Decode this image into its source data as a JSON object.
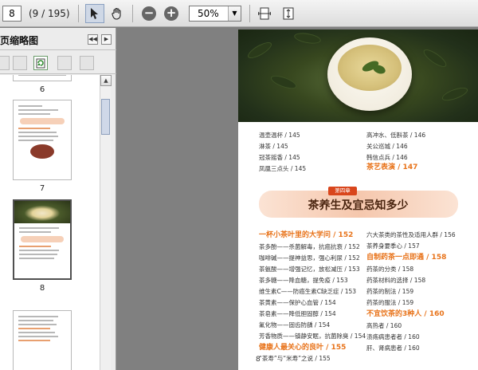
{
  "toolbar": {
    "page_number": "8",
    "page_count": "(9 / 195)",
    "zoom": "50%",
    "icons": [
      "select-icon",
      "hand-icon",
      "zoom-out-icon",
      "zoom-in-icon",
      "fit-width-icon",
      "fit-page-icon"
    ]
  },
  "panel": {
    "title": "页缩略图",
    "thumbnails": [
      {
        "label": "6"
      },
      {
        "label": "7"
      },
      {
        "label": "8"
      }
    ]
  },
  "page": {
    "left_col": [
      "温壶温杯 / 145",
      "淋茶 / 145",
      "冠茶摇香 / 145",
      "凤凰三点头 / 145"
    ],
    "right_col_top": [
      "高冲水、低斟茶 / 146",
      "关公巡城 / 146",
      "韩信点兵 / 146"
    ],
    "section1_heading": "茶艺表演 / 147",
    "chapter_badge": "第四章",
    "chapter_title": "茶养生及宜忌知多少",
    "left_list_heading": "一杯小茶叶里的大学问 / 152",
    "left_list": [
      "茶多酚——杀菌解毒，抗癌抗衰 / 152",
      "咖啡碱——提神益思，强心利尿 / 152",
      "茶氨酸——增强记忆，放松减压 / 153",
      "茶多糖——降血糖，提免疫 / 153",
      "维生素C——防癌生素C缺乏症 / 153",
      "茶黄素——保护心血管 / 154",
      "茶皂素——降低胆固醇 / 154",
      "氟化物——固齿防龋 / 154",
      "芳香物质——镇静安眠，抗菌除臭 / 154"
    ],
    "left_list_heading2": "健康人最关心的良叶 / 155",
    "left_list_last": "“茶寿”与“米寿”之说 / 155",
    "right_list_top": [
      "六大茶类的茶性及适用人群 / 156",
      "茶养身要季心 / 157"
    ],
    "right_list_heading": "自制药茶一点即通 / 158",
    "right_list": [
      "药茶的分类 / 158",
      "药茶材料的选择 / 158",
      "药茶的制法 / 159",
      "药茶的服法 / 159"
    ],
    "right_list_heading2": "不宜饮茶的3种人 / 160",
    "right_list_last": [
      "高热者 / 160",
      "溃疡病患者者 / 160",
      "肝、肾病患者 / 160"
    ],
    "page_num": "8"
  }
}
